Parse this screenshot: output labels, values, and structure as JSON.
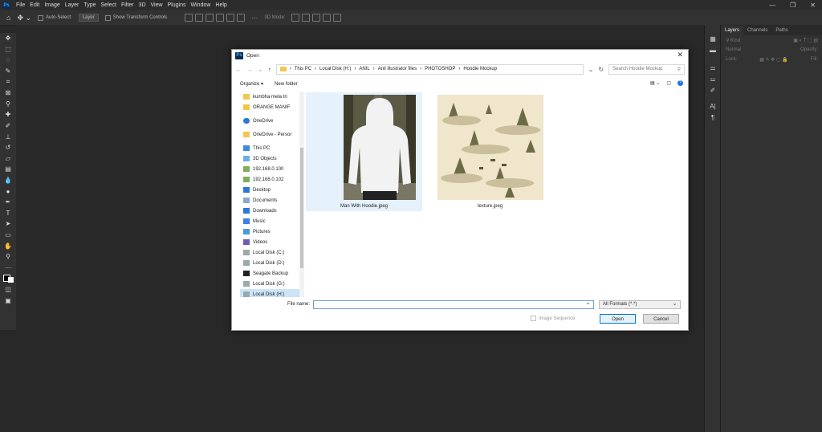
{
  "app": {
    "logo": "Ps",
    "menus": [
      "File",
      "Edit",
      "Image",
      "Layer",
      "Type",
      "Select",
      "Filter",
      "3D",
      "View",
      "Plugins",
      "Window",
      "Help"
    ],
    "window_controls": [
      "—",
      "❐",
      "✕"
    ]
  },
  "options_bar": {
    "auto_select_label": "Auto-Select:",
    "layer_value": "Layer",
    "show_transform_label": "Show Transform Controls",
    "mode_3d_label": "3D Mode:"
  },
  "panels": {
    "tabs": [
      "Layers",
      "Channels",
      "Paths"
    ],
    "kind_label": "Normal",
    "opacity_label": "Opacity:",
    "lock_label": "Lock:",
    "fill_label": "Fill:"
  },
  "dialog": {
    "title": "Open",
    "address": [
      "This PC",
      "Local Disk (H:)",
      "ANIL",
      "Anil illustrator files",
      "PHOTOSHOP",
      "Hoodie Mockup"
    ],
    "search_placeholder": "Search Hoodie Mockup",
    "organize_label": "Organize ▾",
    "new_folder_label": "New folder",
    "sidebar": [
      {
        "label": "kumbha mela tri",
        "icon": "folder-icon"
      },
      {
        "label": "ORANGE MANIF",
        "icon": "folder-icon"
      },
      {
        "label": "OneDrive",
        "icon": "cloud-icon"
      },
      {
        "label": "OneDrive - Persor",
        "icon": "folder-icon"
      },
      {
        "label": "This PC",
        "icon": "computer-icon"
      },
      {
        "label": "3D Objects",
        "icon": "cube-icon"
      },
      {
        "label": "192.168.0.100",
        "icon": "network-drive-icon"
      },
      {
        "label": "192.168.0.102",
        "icon": "network-drive-icon"
      },
      {
        "label": "Desktop",
        "icon": "desktop-icon"
      },
      {
        "label": "Documents",
        "icon": "documents-icon"
      },
      {
        "label": "Downloads",
        "icon": "downloads-icon"
      },
      {
        "label": "Music",
        "icon": "music-icon"
      },
      {
        "label": "Pictures",
        "icon": "pictures-icon"
      },
      {
        "label": "Videos",
        "icon": "videos-icon"
      },
      {
        "label": "Local Disk (C:)",
        "icon": "disk-icon"
      },
      {
        "label": "Local Disk (D:)",
        "icon": "disk-icon"
      },
      {
        "label": "Seagate Backup",
        "icon": "external-drive-icon"
      },
      {
        "label": "Local Disk (G:)",
        "icon": "disk-icon"
      },
      {
        "label": "Local Disk (H:)",
        "icon": "disk-icon"
      }
    ],
    "files": [
      {
        "name": "Man With Hoodie.jpeg"
      },
      {
        "name": "texture.jpeg"
      }
    ],
    "file_name_label": "File name:",
    "file_name_value": "",
    "format_value": "All Formats (*.*)",
    "image_sequence_label": "Image Sequence",
    "open_label": "Open",
    "cancel_label": "Cancel"
  },
  "colors": {
    "accent": "#0078d7",
    "selection": "#cce4f7",
    "ps_bg": "#282828"
  }
}
